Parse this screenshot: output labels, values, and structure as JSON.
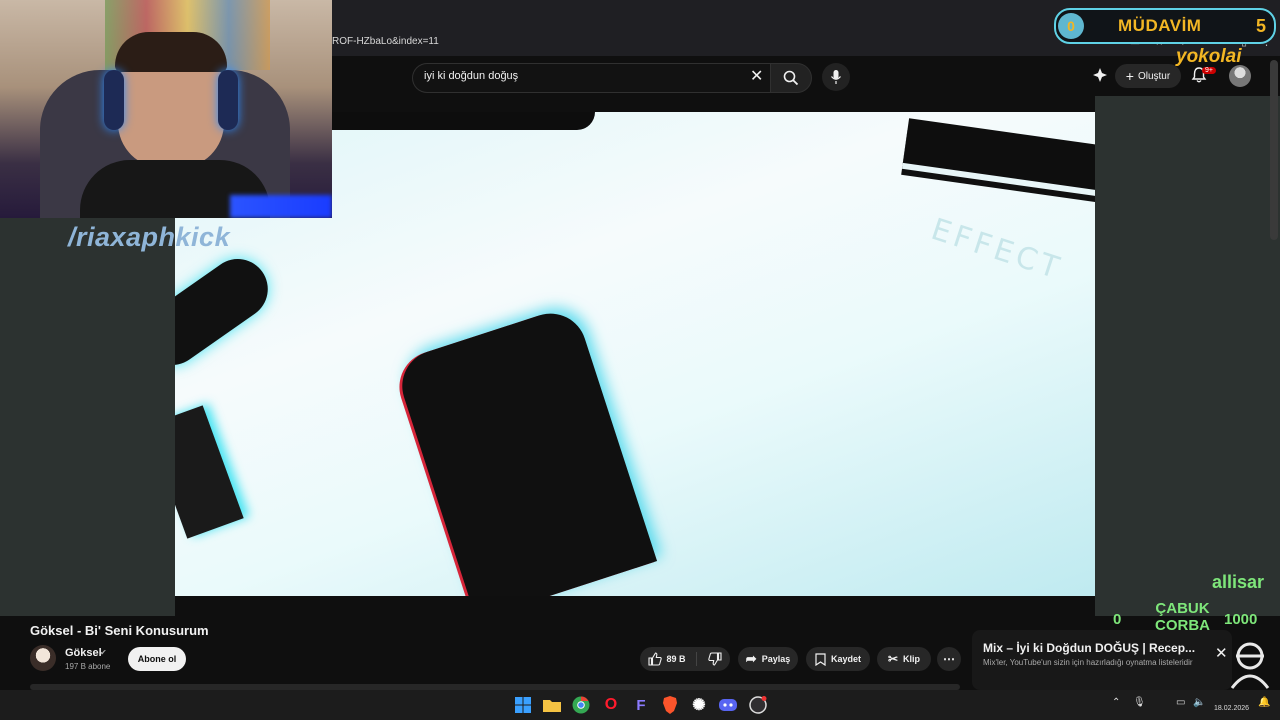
{
  "browser": {
    "url_fragment": "ROF-HZbaLo&index=11"
  },
  "youtube": {
    "search_query": "iyi ki doğdun doğuş",
    "create_label": "Oluştur",
    "notification_badge": "9+"
  },
  "video": {
    "overlay_text": "EFFECT",
    "title": "Göksel - Bi' Seni Konusurum",
    "channel_name": "Göksel",
    "subscriber_count": "197 B abone",
    "subscribe_label": "Abone ol",
    "like_count": "89 B",
    "share_label": "Paylaş",
    "save_label": "Kaydet",
    "clip_label": "Klip"
  },
  "mix_card": {
    "title": "Mix – İyi ki Doğdun DOĞUŞ | Recep...",
    "subtitle": "Mix'ler, YouTube'un sizin için hazırladığı oynatma listeleridir"
  },
  "stream_overlay": {
    "kick_handle": "/riaxaphkick",
    "badge_coin": "0",
    "badge_title": "MÜDAVİM",
    "badge_count": "5",
    "yokolai": "yokolai",
    "allisar": "allisar",
    "corba_count": "0",
    "corba_title_line1": "ÇABUK",
    "corba_title_line2": "ÇORBA",
    "corba_amount": "1000"
  },
  "taskbar": {
    "date": "18.02.2026",
    "apps": [
      "windows-start",
      "file-explorer",
      "chrome",
      "opera",
      "app-f",
      "brave",
      "chatgpt",
      "discord",
      "obs"
    ]
  },
  "colors": {
    "gold": "#f2b624",
    "overlay_green": "#7ee67a",
    "badge_border": "#5fd2e6",
    "youtube_red": "#cc0000"
  }
}
